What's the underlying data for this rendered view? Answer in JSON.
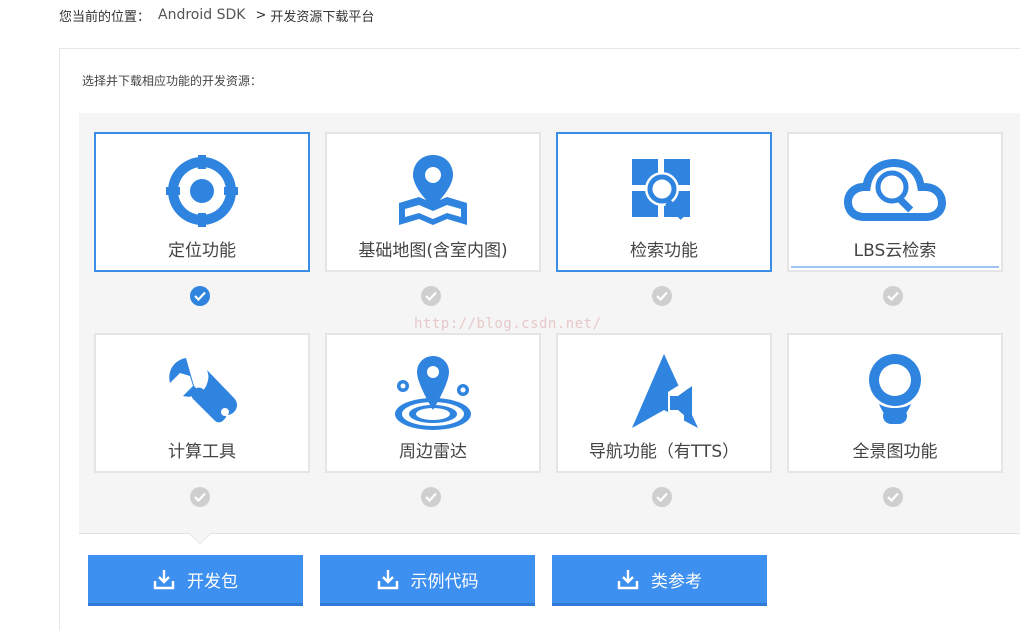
{
  "breadcrumb": {
    "prefix": "您当前的位置：",
    "sdk": "Android SDK",
    "separator": ">",
    "current": "开发资源下载平台"
  },
  "instruction": "选择并下载相应功能的开发资源：",
  "watermark": "http://blog.csdn.net/",
  "features": [
    {
      "label": "定位功能",
      "icon": "location-target-icon",
      "selected": true
    },
    {
      "label": "基础地图(含室内图)",
      "icon": "map-pin-icon",
      "selected": false
    },
    {
      "label": "检索功能",
      "icon": "search-grid-icon",
      "selected": false
    },
    {
      "label": "LBS云检索",
      "icon": "cloud-search-icon",
      "selected": false
    },
    {
      "label": "计算工具",
      "icon": "wrench-icon",
      "selected": false
    },
    {
      "label": "周边雷达",
      "icon": "radar-icon",
      "selected": false
    },
    {
      "label": "导航功能（有TTS）",
      "icon": "navigation-icon",
      "selected": false
    },
    {
      "label": "全景图功能",
      "icon": "panorama-icon",
      "selected": false
    }
  ],
  "buttons": {
    "dev_package": "开发包",
    "sample_code": "示例代码",
    "class_reference": "类参考"
  },
  "colors": {
    "accent": "#3d8ff0",
    "icon_blue": "#2f84e0",
    "check_off": "#cfcfcf"
  }
}
